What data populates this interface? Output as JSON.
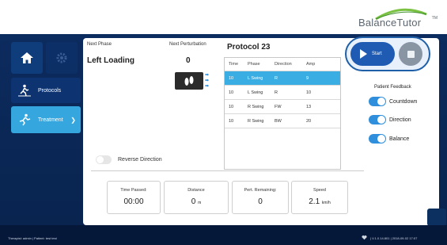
{
  "brand": {
    "logo_text": "BalanceTutor",
    "tm": "TM"
  },
  "sidebar": {
    "items": [
      {
        "label": "Protocols"
      },
      {
        "label": "Treatment"
      }
    ]
  },
  "main": {
    "next_phase_label": "Next Phase",
    "next_phase_value": "Left Loading",
    "next_perturbation_label": "Next Perturbation",
    "next_perturbation_value": "0",
    "protocol_title": "Protocol 23",
    "reverse_direction_label": "Reverse Direction"
  },
  "table": {
    "headers": [
      "Time",
      "Phase",
      "Direction",
      "Amp"
    ],
    "rows": [
      {
        "time": "10",
        "phase": "L Swing",
        "direction": "R",
        "amp": "9"
      },
      {
        "time": "10",
        "phase": "L Swing",
        "direction": "R",
        "amp": "10"
      },
      {
        "time": "10",
        "phase": "R Swing",
        "direction": "FW",
        "amp": "13"
      },
      {
        "time": "10",
        "phase": "R Swing",
        "direction": "BW",
        "amp": "20"
      }
    ]
  },
  "controls": {
    "start_label": "Start"
  },
  "feedback": {
    "title": "Patient Feedback",
    "items": [
      {
        "label": "Countdown"
      },
      {
        "label": "Direction"
      },
      {
        "label": "Balance"
      }
    ]
  },
  "stats": {
    "time_passed_label": "Time Passed:",
    "time_passed_value": "00:00",
    "distance_label": "Distance",
    "distance_value": "0",
    "distance_unit": "m",
    "pert_remaining_label": "Pert. Remaining:",
    "pert_remaining_value": "0",
    "speed_label": "Speed",
    "speed_value": "2.1",
    "speed_unit": "km/h"
  },
  "footer": {
    "left": "Therapist: admin  |  Patient: test test",
    "right": "|  V.1.0.14.801  |  2018-09-02 17:07"
  },
  "colors": {
    "accent": "#35a7de",
    "navy": "#08234d",
    "selected_row": "#3aaee3"
  }
}
